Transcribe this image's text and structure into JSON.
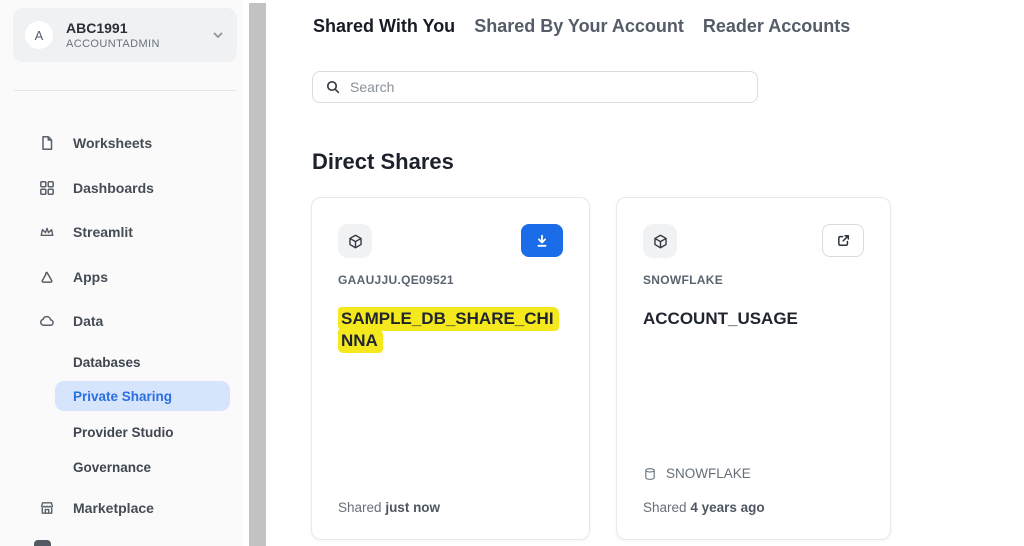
{
  "sidebar": {
    "account": {
      "initial": "A",
      "name": "ABC1991",
      "role": "ACCOUNTADMIN"
    },
    "items": [
      {
        "label": "Worksheets"
      },
      {
        "label": "Dashboards"
      },
      {
        "label": "Streamlit"
      },
      {
        "label": "Apps"
      },
      {
        "label": "Data"
      },
      {
        "label": "Marketplace"
      }
    ],
    "data_subitems": [
      {
        "label": "Databases",
        "selected": false
      },
      {
        "label": "Private Sharing",
        "selected": true
      },
      {
        "label": "Provider Studio",
        "selected": false
      },
      {
        "label": "Governance",
        "selected": false
      }
    ]
  },
  "header_tabs": [
    {
      "label": "Shared With You",
      "active": true
    },
    {
      "label": "Shared By Your Account",
      "active": false
    },
    {
      "label": "Reader Accounts",
      "active": false
    }
  ],
  "search": {
    "placeholder": "Search"
  },
  "main": {
    "section_title": "Direct Shares"
  },
  "cards": [
    {
      "org": "GAAUJJU.QE09521",
      "title": "SAMPLE_DB_SHARE_CHINNA",
      "action": "download",
      "shared_label": "Shared",
      "shared_time": "just now",
      "highlighted": true
    },
    {
      "org": "SNOWFLAKE",
      "title": "ACCOUNT_USAGE",
      "action": "open-external",
      "database": "SNOWFLAKE",
      "shared_label": "Shared",
      "shared_time": "4 years ago",
      "highlighted": false
    }
  ],
  "colors": {
    "accent_blue": "#1a6ce8",
    "selected_pill_bg": "#d7e5fc",
    "selected_pill_text": "#2a6fe2",
    "highlight_yellow": "#f5e91e",
    "sidebar_bg": "#fafafa"
  }
}
